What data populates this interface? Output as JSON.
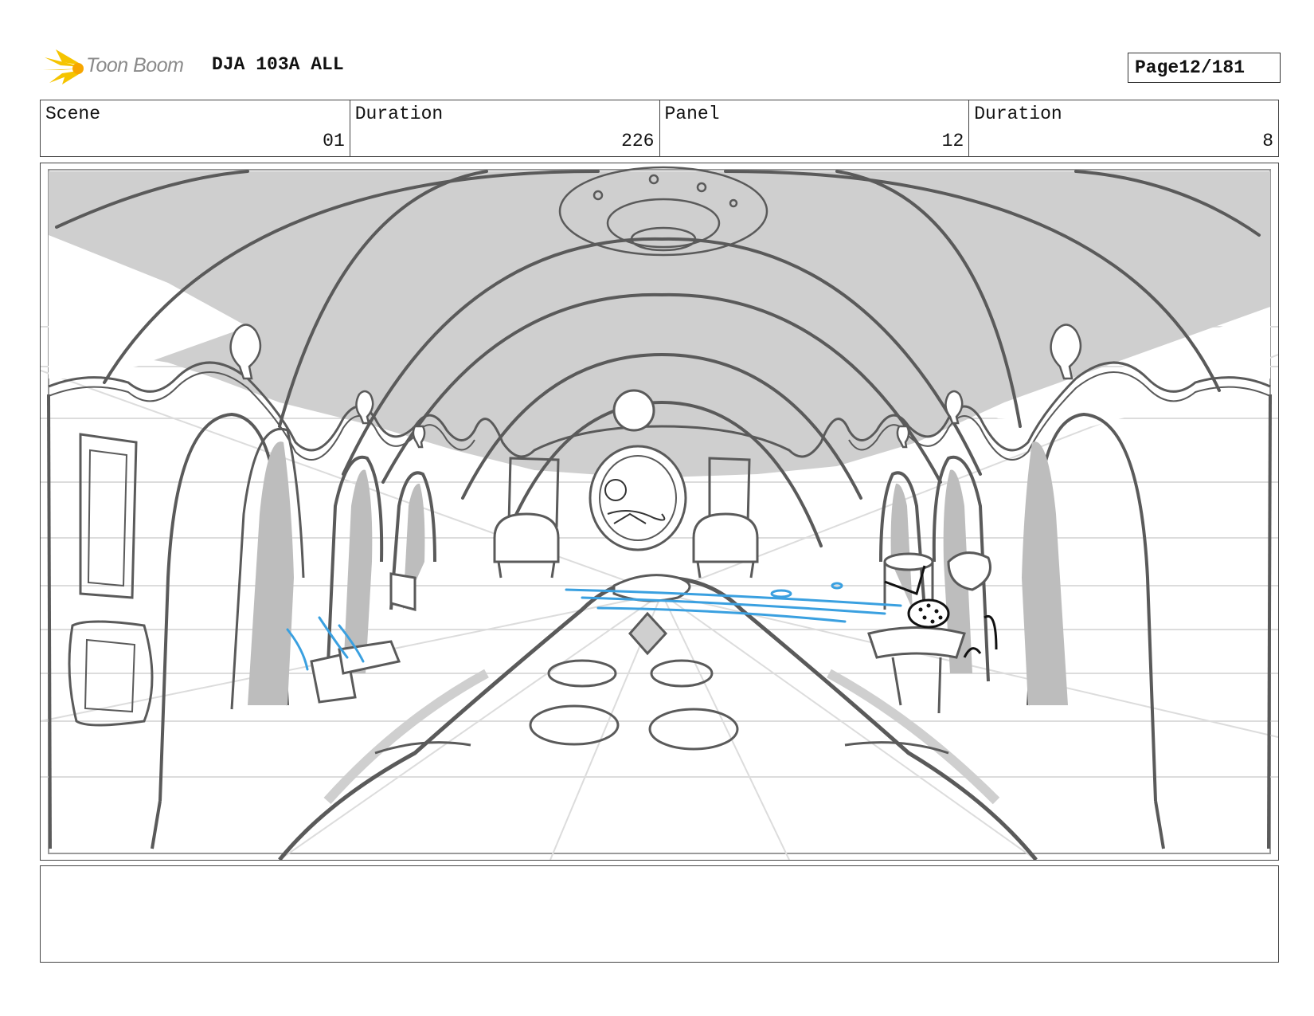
{
  "header": {
    "logo_text": "Toon Boom",
    "project_title": "DJA 103A ALL",
    "page_label": "Page",
    "page_value": "12/181"
  },
  "info": {
    "scene_label": "Scene",
    "scene_value": "01",
    "scene_duration_label": "Duration",
    "scene_duration_value": "226",
    "panel_label": "Panel",
    "panel_value": "12",
    "panel_duration_label": "Duration",
    "panel_duration_value": "8"
  },
  "notes": {
    "text": ""
  },
  "colors": {
    "sketch_gray": "#5a5a5a",
    "shadow_gray": "#cfcfcf",
    "action_blue": "#3aa0e0",
    "logo_yellow": "#f5c400"
  }
}
